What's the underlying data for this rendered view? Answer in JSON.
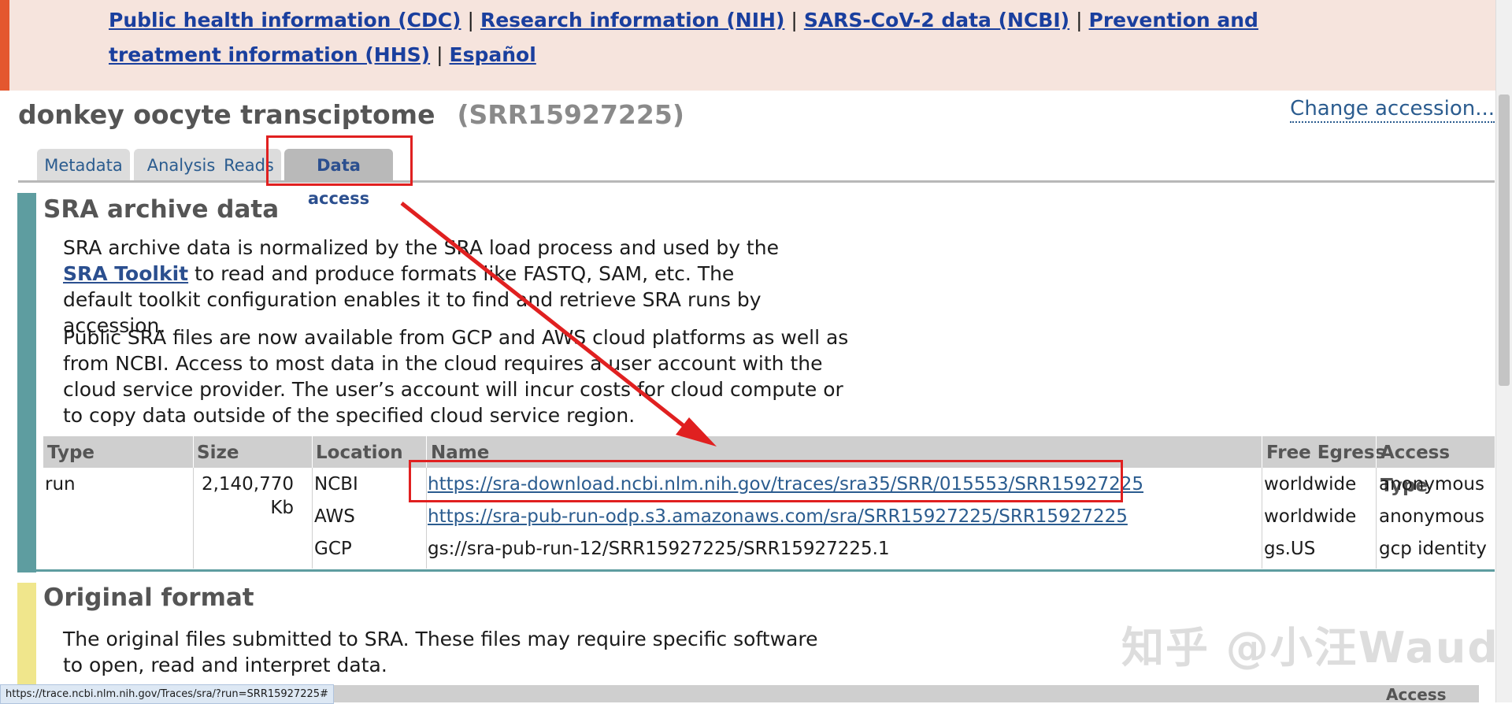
{
  "banner": {
    "links": [
      "Public health information (CDC)",
      "Research information (NIH)",
      "SARS-CoV-2 data (NCBI)",
      "Prevention and treatment information (HHS)",
      "Español"
    ],
    "separator": "|"
  },
  "header": {
    "title": "donkey oocyte transciptome",
    "accession": "(SRR15927225)",
    "change_accession": "Change accession..."
  },
  "tabs": [
    {
      "label": "Metadata"
    },
    {
      "label": "Analysis"
    },
    {
      "label": "Reads"
    },
    {
      "label": "Data access",
      "active": true
    }
  ],
  "sra_archive": {
    "title": "SRA archive data",
    "para1_before": "SRA archive data is normalized by the SRA load process and used by the ",
    "para1_link": "SRA Toolkit",
    "para1_after": " to read and produce formats like FASTQ, SAM, etc. The default toolkit configuration enables it to find and retrieve SRA runs by accession.",
    "para2": "Public SRA files are now available from GCP and AWS cloud platforms as well as from NCBI. Access to most data in the cloud requires a user account with the cloud service provider. The user’s account will incur costs for cloud compute or to copy data outside of the specified cloud service region.",
    "table": {
      "headers": [
        "Type",
        "Size",
        "Location",
        "Name",
        "Free Egress",
        "Access Type"
      ],
      "type": "run",
      "size_line1": "2,140,770",
      "size_line2": "Kb",
      "rows": [
        {
          "location": "NCBI",
          "name": "https://sra-download.ncbi.nlm.nih.gov/traces/sra35/SRR/015553/SRR15927225",
          "egress": "worldwide",
          "access": "anonymous"
        },
        {
          "location": "AWS",
          "name": "https://sra-pub-run-odp.s3.amazonaws.com/sra/SRR15927225/SRR15927225",
          "egress": "worldwide",
          "access": "anonymous"
        },
        {
          "location": "GCP",
          "name": "gs://sra-pub-run-12/SRR15927225/SRR15927225.1",
          "egress": "gs.US",
          "access": "gcp identity"
        }
      ]
    }
  },
  "original_format": {
    "title": "Original format",
    "para": "The original files submitted to SRA. These files may require specific software to open, read and interpret data."
  },
  "watermark": "知乎 @小汪Waud",
  "status_bar": "https://trace.ncbi.nlm.nih.gov/Traces/sra/?run=SRR15927225#",
  "partial_header": "Access",
  "colors": {
    "annotation_red": "#e02020",
    "teal_bar": "#5e9da0",
    "yellow_bar": "#f0e68c",
    "banner_bg": "#f6e4dd"
  }
}
